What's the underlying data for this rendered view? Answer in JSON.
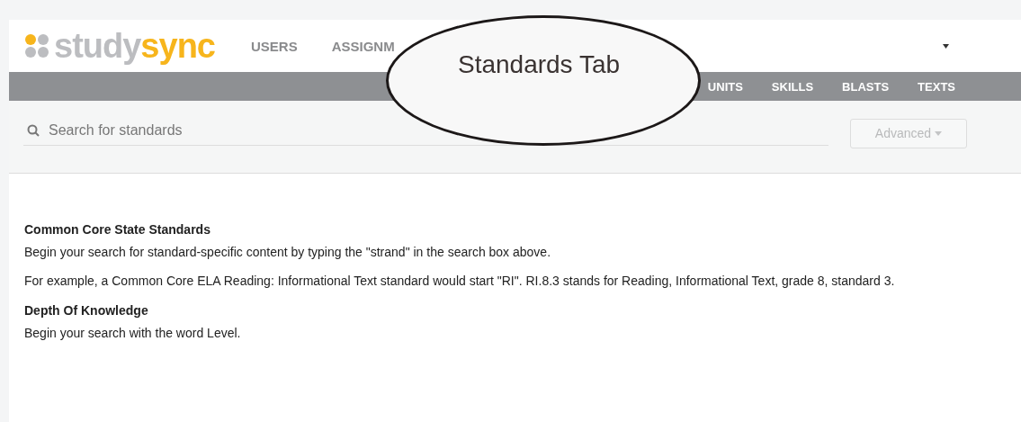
{
  "header": {
    "logo": {
      "left": "study",
      "right": "sync"
    },
    "nav": [
      {
        "label": "USERS"
      },
      {
        "label": "ASSIGNM"
      }
    ]
  },
  "subnav": [
    {
      "label": "UNITS"
    },
    {
      "label": "SKILLS"
    },
    {
      "label": "BLASTS"
    },
    {
      "label": "TEXTS"
    }
  ],
  "search": {
    "placeholder": "Search for standards",
    "advanced_button": "Advanced"
  },
  "sections": [
    {
      "title": "Common Core State Standards",
      "paragraphs": [
        "Begin your search for standard-specific content by typing the \"strand\" in the search box above.",
        "For example, a Common Core ELA Reading: Informational Text standard would start \"RI\". RI.8.3 stands for Reading, Informational Text, grade 8, standard 3."
      ]
    },
    {
      "title": "Depth Of Knowledge",
      "paragraphs": [
        "Begin your search with the word Level."
      ]
    }
  ],
  "callout": {
    "label": "Standards Tab"
  }
}
